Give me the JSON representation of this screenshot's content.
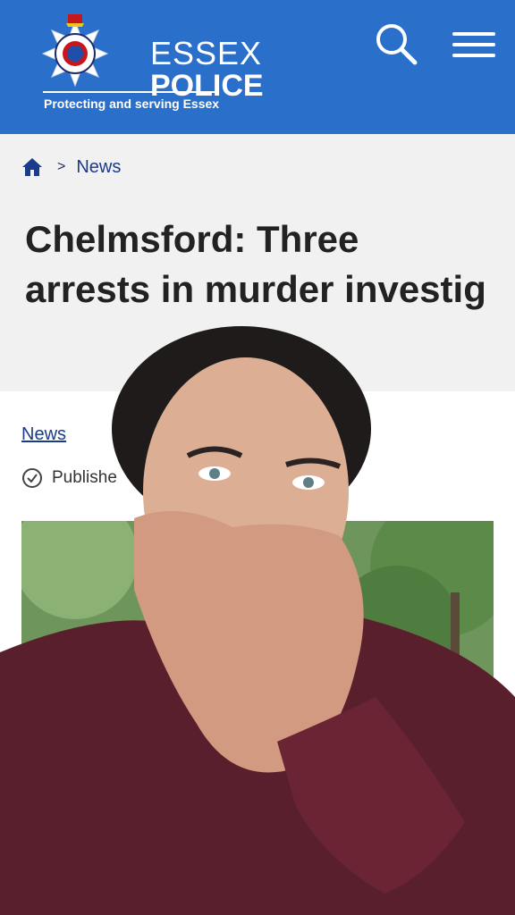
{
  "header": {
    "brand_line1": "ESSEX",
    "brand_line2": "POLICE",
    "tagline": "Protecting and serving Essex",
    "badge_icon": "police-crest-icon",
    "search_icon": "search-icon",
    "menu_icon": "hamburger-menu-icon",
    "color": "#2a6fc9"
  },
  "breadcrumb": {
    "home_icon": "home-icon",
    "separator": ">",
    "current": "News"
  },
  "article": {
    "title": "Chelmsford: Three arrests in murder investig",
    "category": "News",
    "published_label": "Publishe",
    "published_icon": "check-circle-icon"
  },
  "colors": {
    "band": "#f1f1f1",
    "link": "#1a3a8c",
    "title": "#222222"
  }
}
